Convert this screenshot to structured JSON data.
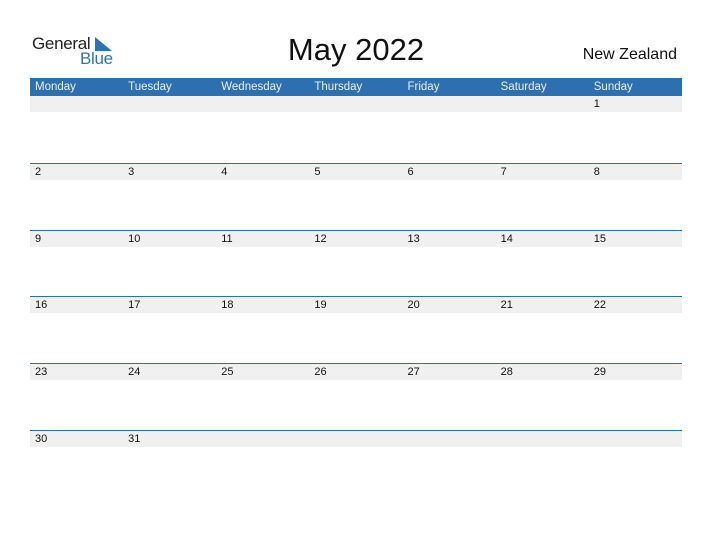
{
  "logo": {
    "general": "General",
    "blue": "Blue"
  },
  "title": "May 2022",
  "country": "New Zealand",
  "weekdays": [
    "Monday",
    "Tuesday",
    "Wednesday",
    "Thursday",
    "Friday",
    "Saturday",
    "Sunday"
  ],
  "weeks": [
    [
      "",
      "",
      "",
      "",
      "",
      "",
      "1"
    ],
    [
      "2",
      "3",
      "4",
      "5",
      "6",
      "7",
      "8"
    ],
    [
      "9",
      "10",
      "11",
      "12",
      "13",
      "14",
      "15"
    ],
    [
      "16",
      "17",
      "18",
      "19",
      "20",
      "21",
      "22"
    ],
    [
      "23",
      "24",
      "25",
      "26",
      "27",
      "28",
      "29"
    ],
    [
      "30",
      "31",
      "",
      "",
      "",
      "",
      ""
    ]
  ],
  "colors": {
    "accent": "#2e6fb0",
    "strip": "#f0f0f0"
  }
}
